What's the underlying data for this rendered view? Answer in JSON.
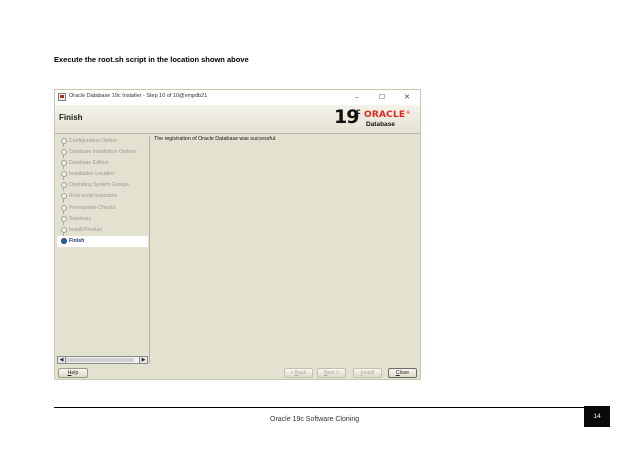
{
  "document": {
    "heading": "Execute the root.sh script in the location shown above",
    "footer_text": "Oracle 19c Software Cloning",
    "page_number": "14"
  },
  "window": {
    "title": "Oracle Database 19c Installer - Step 10 of 10@vmpdb21",
    "minimize_icon": "minimize-icon",
    "maximize_icon": "maximize-icon",
    "close_icon": "close-icon"
  },
  "header": {
    "page_title": "Finish",
    "brand_version": "19",
    "brand_suffix": "c",
    "brand_name": "ORACLE",
    "brand_product": "Database"
  },
  "nav": {
    "items": [
      {
        "label": "Configuration Option",
        "state": "done"
      },
      {
        "label": "Database Installation Options",
        "state": "done"
      },
      {
        "label": "Database Edition",
        "state": "done"
      },
      {
        "label": "Installation Location",
        "state": "done"
      },
      {
        "label": "Operating System Groups",
        "state": "done"
      },
      {
        "label": "Root script execution",
        "state": "done"
      },
      {
        "label": "Prerequisite Checks",
        "state": "done"
      },
      {
        "label": "Summary",
        "state": "done"
      },
      {
        "label": "Install Product",
        "state": "done"
      },
      {
        "label": "Finish",
        "state": "current"
      }
    ],
    "scroll_left_icon": "left-arrow-icon",
    "scroll_right_icon": "right-arrow-icon"
  },
  "content": {
    "message": "The registration of Oracle Database  was successful."
  },
  "buttons": {
    "help": {
      "pre": "",
      "mn": "H",
      "post": "elp"
    },
    "back": {
      "pre": "< ",
      "mn": "B",
      "post": "ack"
    },
    "next": {
      "pre": "",
      "mn": "N",
      "post": "ext >"
    },
    "install": {
      "pre": "",
      "mn": "I",
      "post": "nstall"
    },
    "close": {
      "pre": "",
      "mn": "C",
      "post": "lose"
    }
  },
  "colors": {
    "oracle_red": "#e0261f",
    "panel_bg": "#e3e1cf",
    "current_step": "#1b3a73"
  }
}
